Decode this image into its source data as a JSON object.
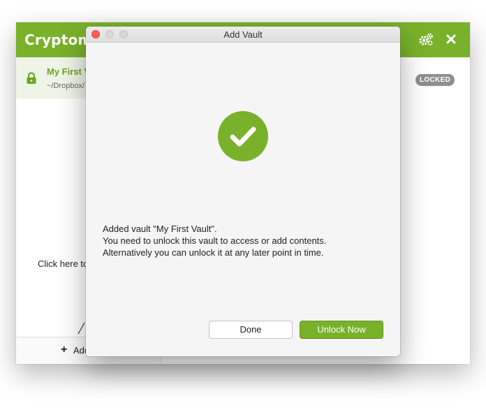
{
  "app": {
    "title": "Cryptomator",
    "icons": {
      "settings": "gears-icon",
      "close": "close-icon"
    },
    "accent_color": "#79b12a"
  },
  "sidebar": {
    "vault": {
      "name": "My First Vault",
      "path": "~/Dropbox/"
    },
    "hint": "Click here to add a vault",
    "add_label": "Add Vault"
  },
  "content": {
    "status_badge": "LOCKED"
  },
  "dialog": {
    "title": "Add Vault",
    "message_lines": [
      "Added vault \"My First Vault\".",
      "You need to unlock this vault to access or add contents.",
      "Alternatively you can unlock it at any later point in time."
    ],
    "buttons": {
      "done": "Done",
      "unlock": "Unlock Now"
    },
    "success_icon": "checkmark-circle-icon"
  }
}
